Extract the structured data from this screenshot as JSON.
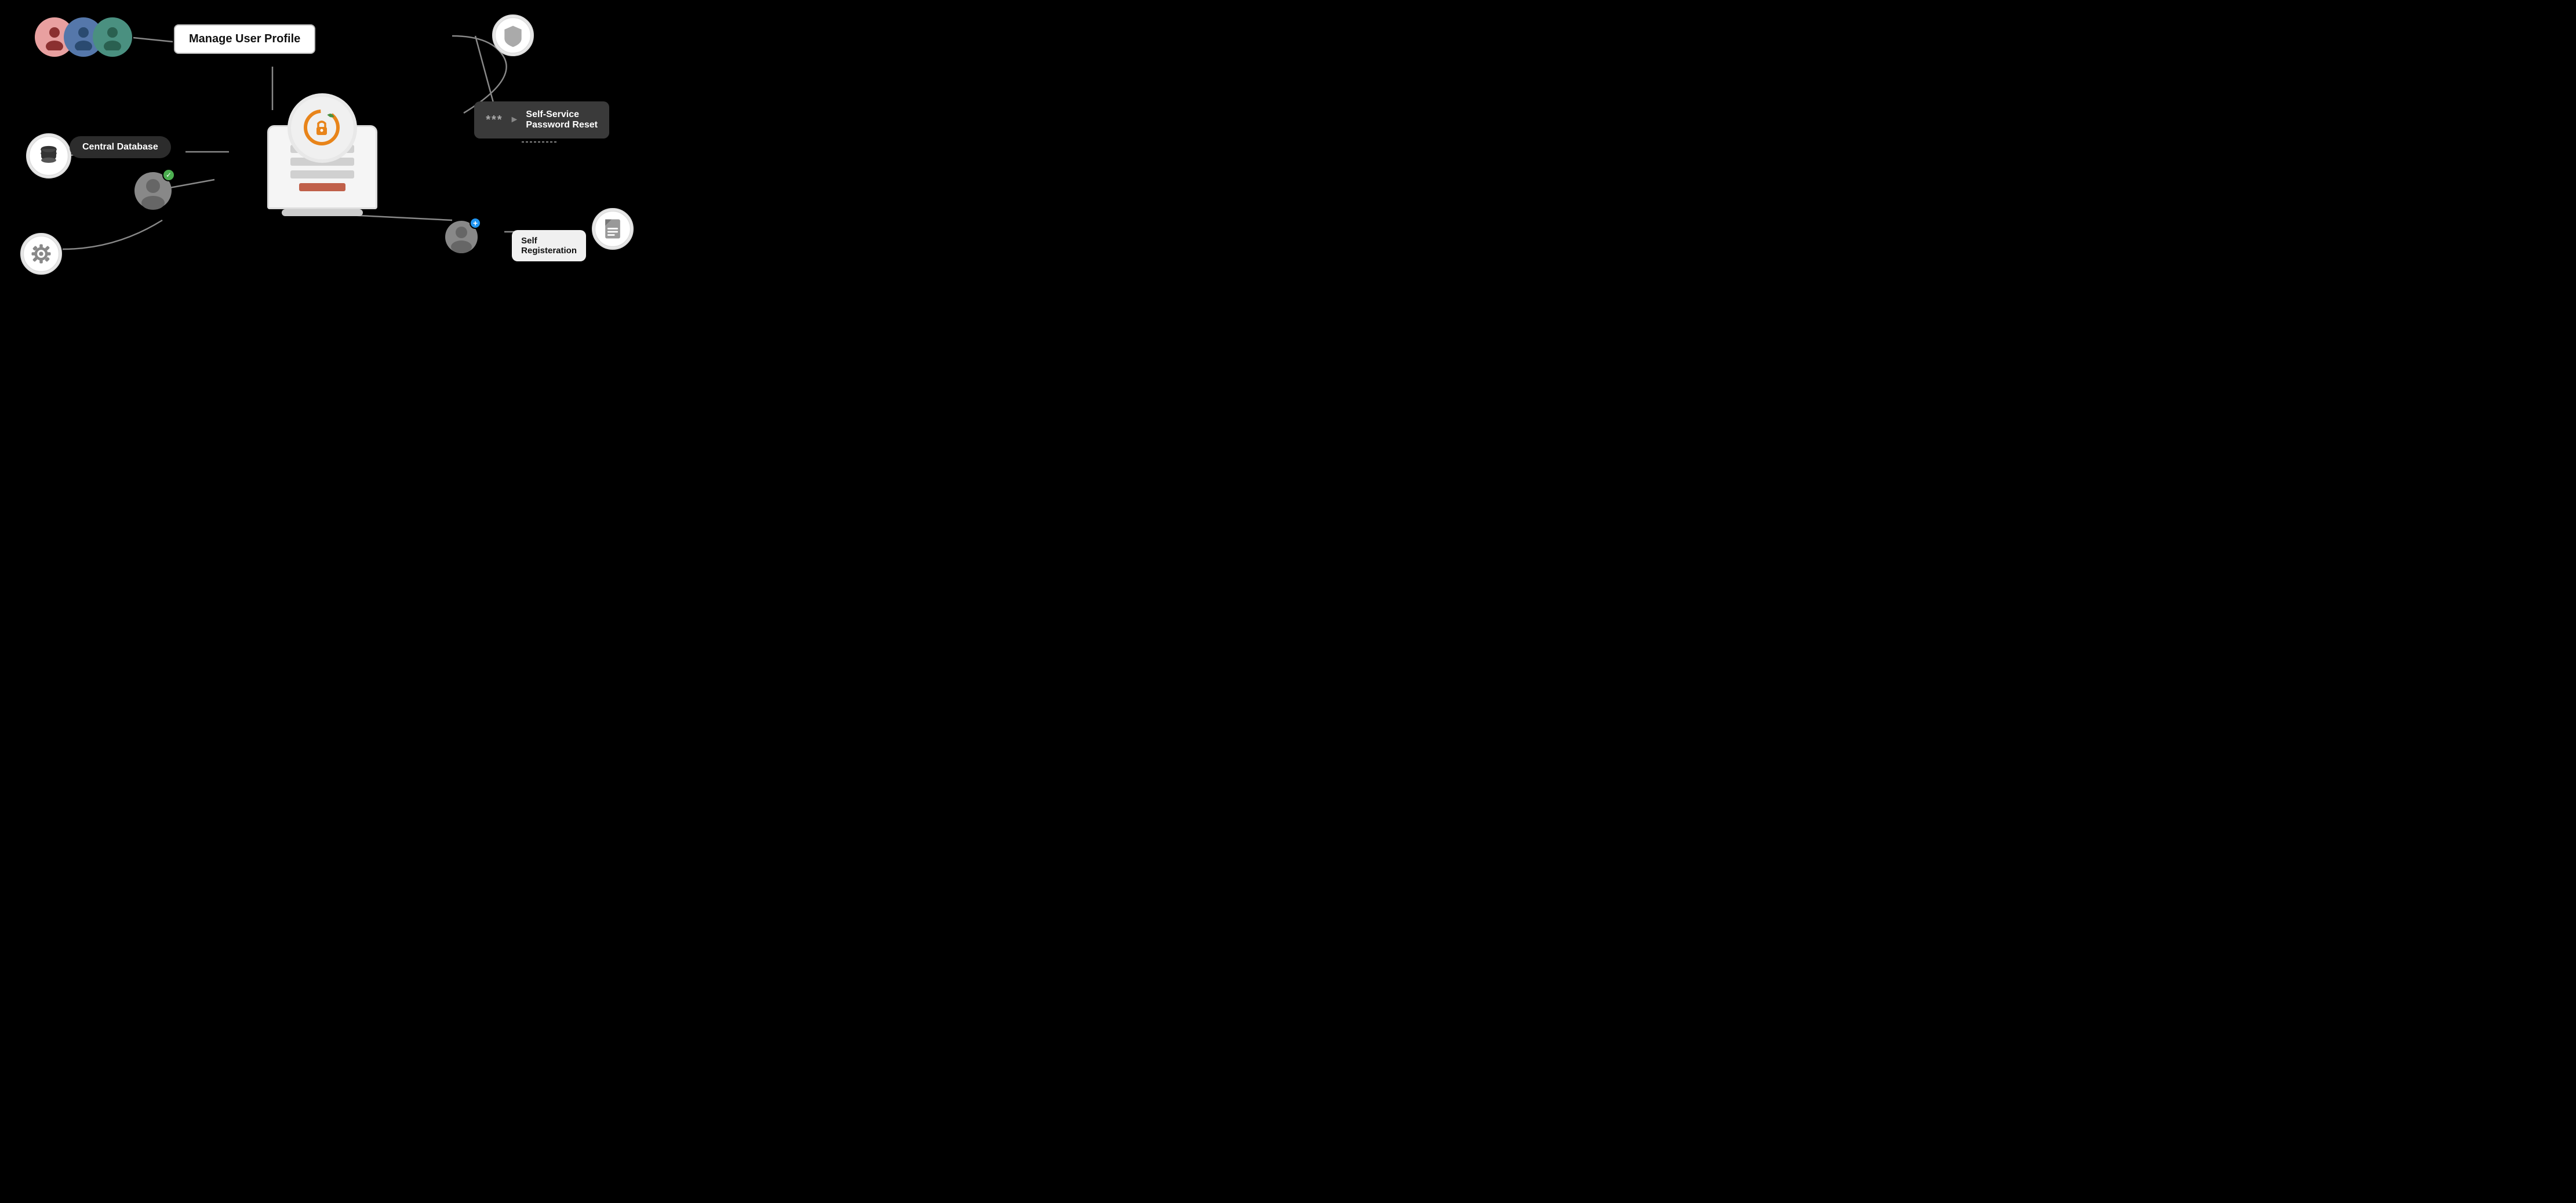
{
  "labels": {
    "manage_user_profile": "Manage User Profile",
    "central_database": "Central Database",
    "self_service_password_reset": "Self-Service\nPassword Reset",
    "self_registration_title": "Self",
    "self_registration_sub": "Registeration",
    "asterisks": "***",
    "arrow": "►"
  },
  "colors": {
    "bg": "#000000",
    "white": "#ffffff",
    "orange": "#E8841A",
    "teal_leaf": "#4a9040",
    "node_border": "#e0e0e0",
    "dark_label_bg": "#3a3a3a",
    "light_label_bg": "#f0f0f0",
    "avatar_pink": "#e8a0a0",
    "avatar_blue": "#4d6fa0",
    "avatar_teal": "#4a8870",
    "connection_line": "#cccccc",
    "plus_blue": "#2196F3"
  }
}
